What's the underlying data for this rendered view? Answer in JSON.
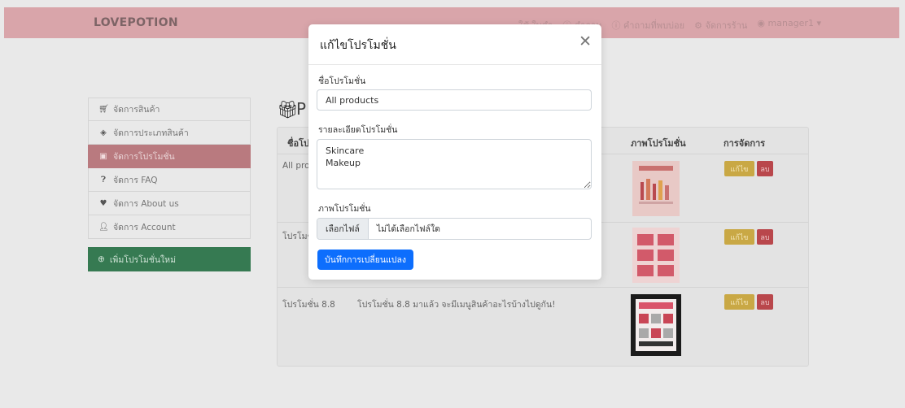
{
  "navbar": {
    "brand": "LOVEPOTION",
    "links": [
      "ใช้ ใบคำ",
      "คำถาม",
      "คำถามที่พบบ่อย",
      "จัดการร้าน",
      "manager1"
    ]
  },
  "sidebar": {
    "items": [
      {
        "label": "จัดการสินค้า",
        "icon": "cart-icon"
      },
      {
        "label": "จัดการประเภทสินค้า",
        "icon": "layers-icon"
      },
      {
        "label": "จัดการโปรโมชั่น",
        "icon": "gift-icon"
      },
      {
        "label": "จัดการ FAQ",
        "icon": "question-circle-icon"
      },
      {
        "label": "จัดการ About us",
        "icon": "heart-icon"
      },
      {
        "label": "จัดการ Account",
        "icon": "person-icon"
      }
    ],
    "add_label": "เพิ่มโปรโมชั่นใหม่",
    "active_color": "#b97a7f"
  },
  "main": {
    "heading_fragment": "P",
    "table": {
      "headers": [
        "ชื่อโปร",
        "ภาพโปรโมชั่น",
        "การจัดการ"
      ],
      "rows": [
        {
          "name": "All pro",
          "detail": "",
          "image": "our-products-promo"
        },
        {
          "name": "โปรโมชั",
          "detail": "",
          "image": "coupon-grid-promo"
        },
        {
          "name": "โปรโมชั่น 8.8",
          "detail": "โปรโมชั่น 8.8 มาแล้ว จะมีเมนูสินค้าอะไรบ้างไปดูกัน!",
          "image": "dark-88-promo"
        }
      ],
      "edit_label": "แก้ไข",
      "delete_label": "ลบ"
    }
  },
  "modal": {
    "title": "แก้ไขโปรโมชั่น",
    "name_label": "ชื่อโปรโมชั่น",
    "name_value": "All products",
    "detail_label": "รายละเอียดโปรโมชั่น",
    "detail_value": "Skincare\nMakeup",
    "image_label": "ภาพโปรโมชั่น",
    "file_button": "เลือกไฟล์",
    "file_status": "ไม่ได้เลือกไฟล์ใด",
    "save_label": "บันทึกการเปลี่ยนแปลง",
    "accent": "#0d6efd"
  }
}
